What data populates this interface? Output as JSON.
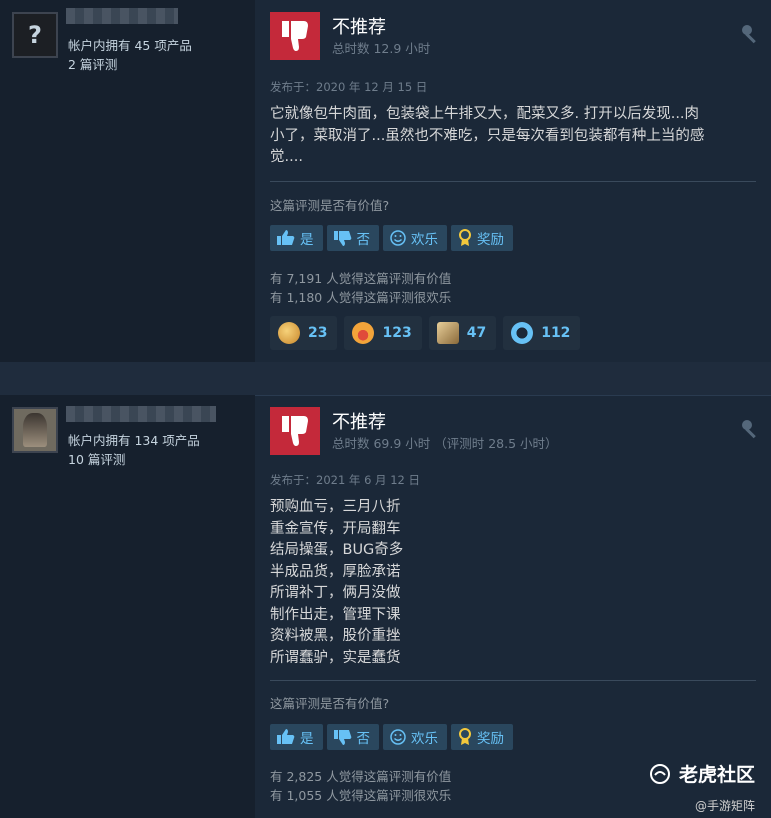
{
  "reviews": [
    {
      "owned": "帐户内拥有 45 项产品",
      "review_count": "2 篇评测",
      "avatar_glyph": "?",
      "recommendation": "不推荐",
      "hours": "总时数 12.9 小时",
      "posted": "发布于：2020 年 12 月 15 日",
      "text": [
        "它就像包牛肉面，包装袋上牛排又大，配菜又多. 打开以后发现...肉",
        "小了，菜取消了...虽然也不难吃，只是每次看到包装都有种上当的感",
        "觉...."
      ],
      "helpful_question": "这篇评测是否有价值?",
      "buttons": {
        "yes": "是",
        "no": "否",
        "funny": "欢乐",
        "award": "奖励"
      },
      "stats": [
        "有 7,191 人觉得这篇评测有价值",
        "有 1,180 人觉得这篇评测很欢乐"
      ],
      "awards": [
        {
          "icon": "laughing-face-icon",
          "count": "23"
        },
        {
          "icon": "screaming-face-icon",
          "count": "123"
        },
        {
          "icon": "scroll-icon",
          "count": "47"
        },
        {
          "icon": "medal-icon",
          "count": "112"
        }
      ]
    },
    {
      "owned": "帐户内拥有 134 项产品",
      "review_count": "10 篇评测",
      "recommendation": "不推荐",
      "hours": "总时数 69.9 小时 （评测时 28.5 小时）",
      "posted": "发布于：2021 年 6 月 12 日",
      "text": [
        "预购血亏，三月八折",
        "重金宣传，开局翻车",
        "结局操蛋，BUG奇多",
        "半成品货，厚脸承诺",
        "所谓补丁，俩月没做",
        "制作出走，管理下课",
        "资料被黑，股价重挫",
        "所谓蠢驴，实是蠢货"
      ],
      "helpful_question": "这篇评测是否有价值?",
      "buttons": {
        "yes": "是",
        "no": "否",
        "funny": "欢乐",
        "award": "奖励"
      },
      "stats": [
        "有 2,825 人觉得这篇评测有价值",
        "有 1,055 人觉得这篇评测很欢乐"
      ]
    }
  ],
  "watermark": {
    "main": "老虎社区",
    "sub": "@手游矩阵"
  },
  "colors": {
    "not_recommended": "#c4293a",
    "link_blue": "#67c1f5",
    "background": "#1b2838"
  }
}
